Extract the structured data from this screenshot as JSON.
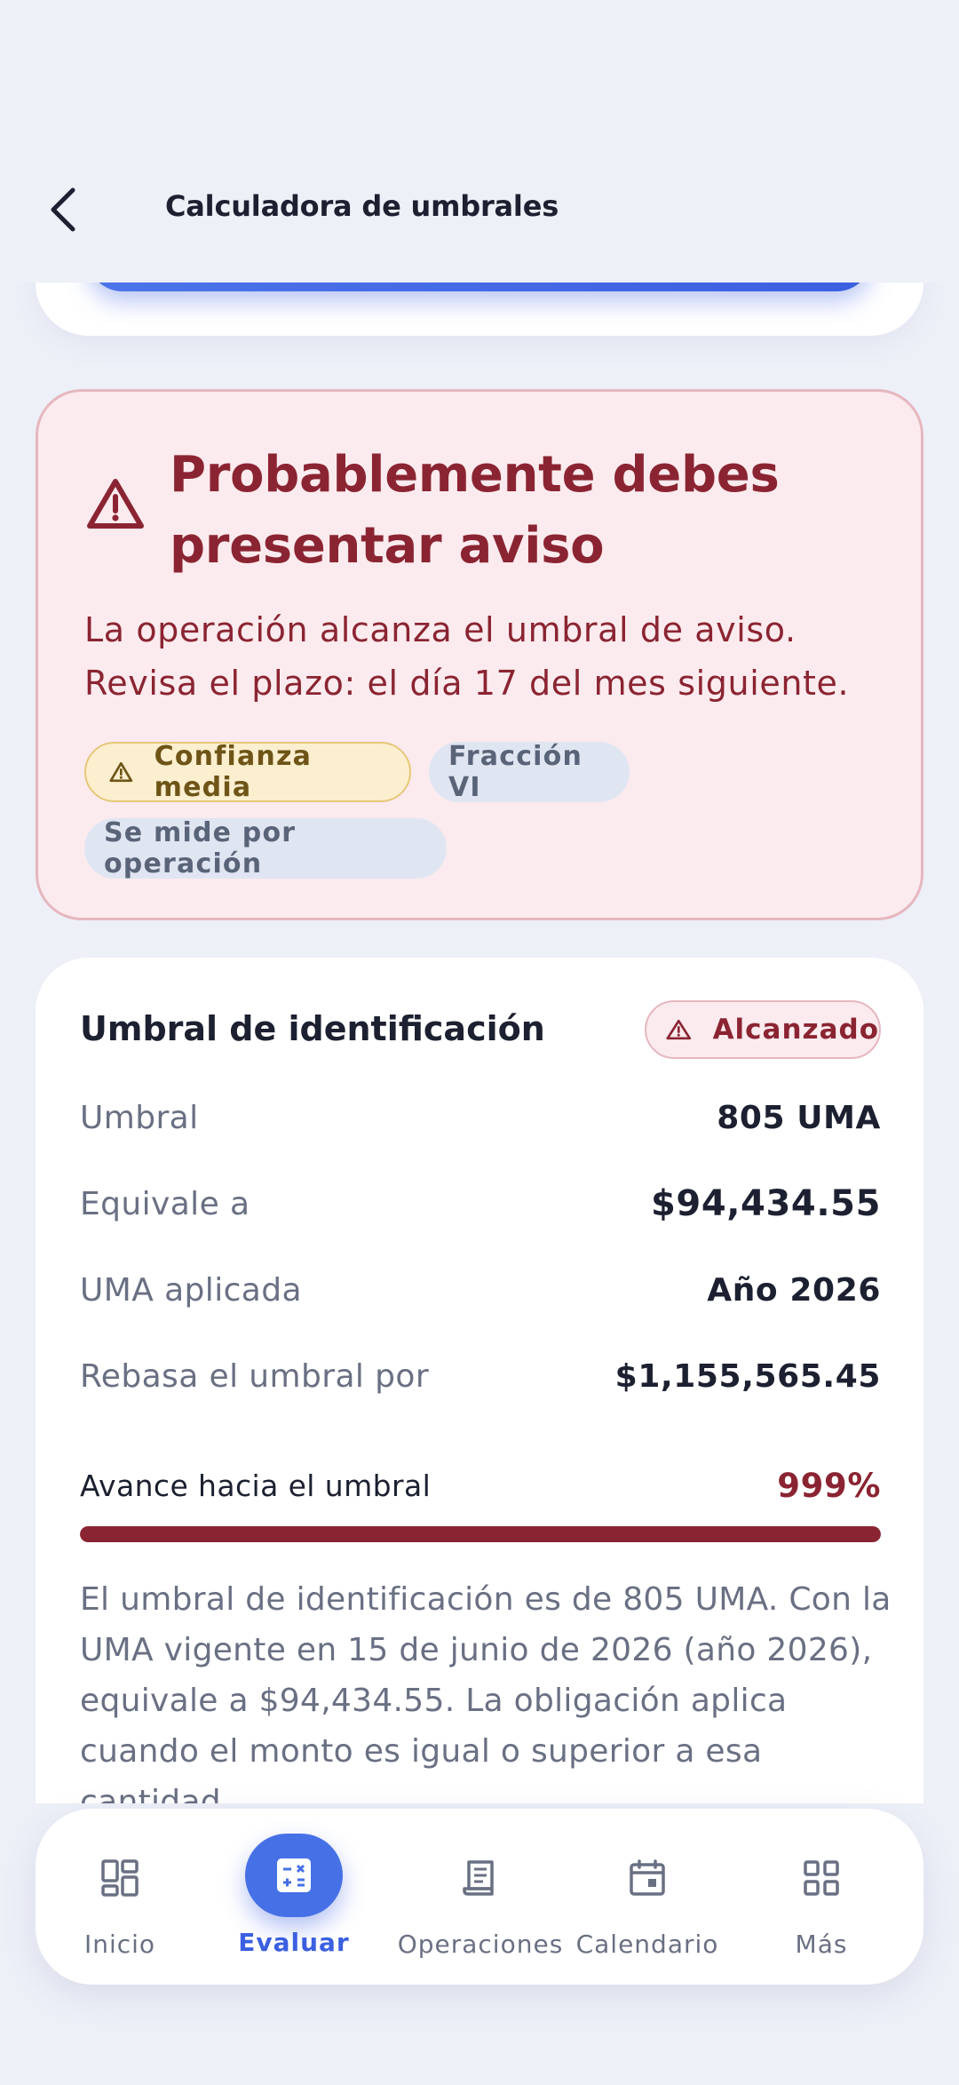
{
  "header": {
    "title": "Calculadora de umbrales"
  },
  "alert": {
    "title": "Probablemente debes presentar aviso",
    "description": "La operación alcanza el umbral de aviso. Revisa el plazo: el día 17 del mes siguiente.",
    "chips": {
      "confidence": "Confianza media",
      "fraction": "Fracción VI",
      "measure": "Se mide por operación"
    },
    "colors": {
      "text": "#8b2432",
      "background": "#fbebee",
      "border": "#e6b7bf"
    }
  },
  "detail": {
    "heading": "Umbral de identificación",
    "status": "Alcanzado",
    "rows": [
      {
        "label": "Umbral",
        "value": "805 UMA"
      },
      {
        "label": "Equivale a",
        "value": "$94,434.55"
      },
      {
        "label": "UMA aplicada",
        "value": "Año 2026"
      },
      {
        "label": "Rebasa el umbral por",
        "value": "$1,155,565.45"
      }
    ],
    "progress": {
      "label": "Avance hacia el umbral",
      "value": "999%",
      "fill_fraction": 1.0
    },
    "explanation": "El umbral de identificación es de 805 UMA. Con la UMA vigente en 15 de junio de 2026 (año 2026), equivale a $94,434.55. La obligación aplica cuando el monto es igual o superior a esa cantidad."
  },
  "nav": {
    "items": [
      {
        "label": "Inicio",
        "icon": "dashboard-icon",
        "active": false
      },
      {
        "label": "Evaluar",
        "icon": "calculator-icon",
        "active": true
      },
      {
        "label": "Operaciones",
        "icon": "receipt-icon",
        "active": false
      },
      {
        "label": "Calendario",
        "icon": "calendar-icon",
        "active": false
      },
      {
        "label": "Más",
        "icon": "grid-icon",
        "active": false
      }
    ],
    "colors": {
      "active": "#3b5fe0",
      "inactive": "#6a7083"
    }
  }
}
